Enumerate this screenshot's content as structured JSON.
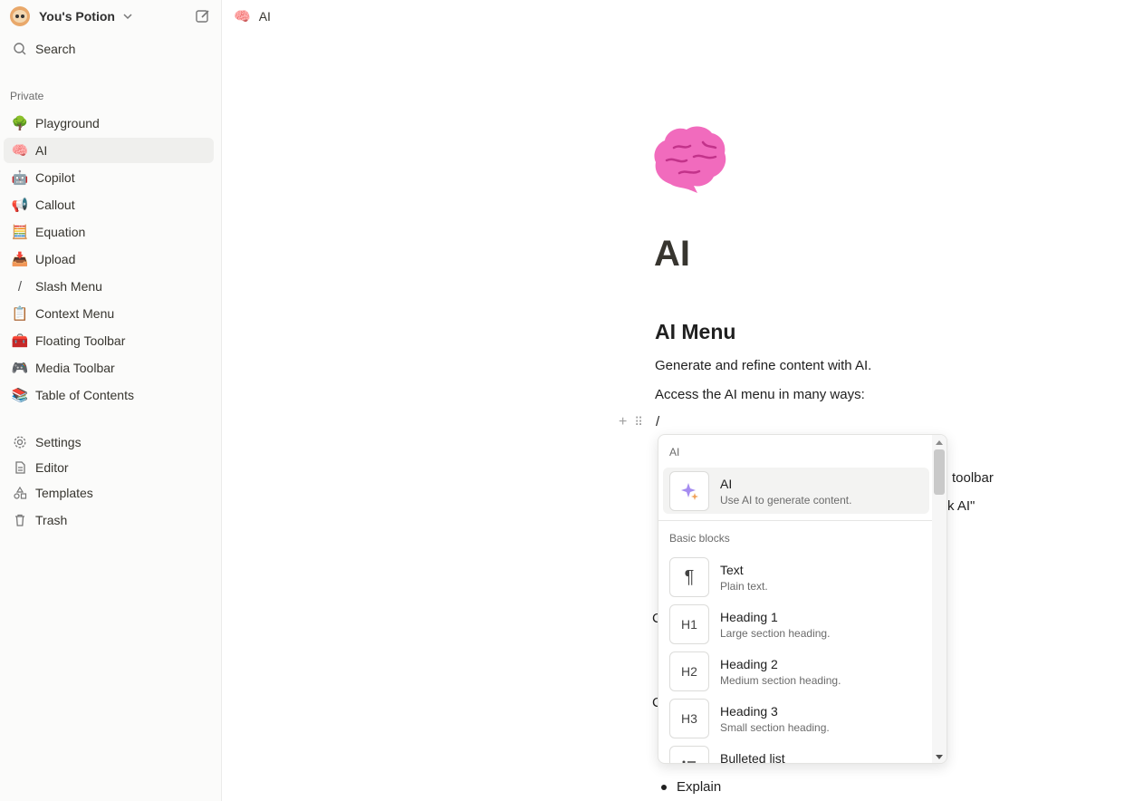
{
  "workspace": {
    "name": "You's Potion"
  },
  "sidebar": {
    "search_label": "Search",
    "section_label": "Private",
    "pages": [
      {
        "label": "Playground",
        "icon": "tree-icon",
        "glyph": "🌳"
      },
      {
        "label": "AI",
        "icon": "brain-icon",
        "glyph": "🧠"
      },
      {
        "label": "Copilot",
        "icon": "robot-icon",
        "glyph": "🤖"
      },
      {
        "label": "Callout",
        "icon": "megaphone-icon",
        "glyph": "📢"
      },
      {
        "label": "Equation",
        "icon": "abacus-icon",
        "glyph": "🧮"
      },
      {
        "label": "Upload",
        "icon": "inbox-tray-icon",
        "glyph": "📥"
      },
      {
        "label": "Slash Menu",
        "icon": "slash-icon",
        "glyph": "/"
      },
      {
        "label": "Context Menu",
        "icon": "clipboard-icon",
        "glyph": "📋"
      },
      {
        "label": "Floating Toolbar",
        "icon": "toolbox-icon",
        "glyph": "🧰"
      },
      {
        "label": "Media Toolbar",
        "icon": "gamepad-icon",
        "glyph": "🎮"
      },
      {
        "label": "Table of Contents",
        "icon": "books-icon",
        "glyph": "📚"
      }
    ],
    "bottom": [
      {
        "label": "Settings",
        "icon": "gear-icon"
      },
      {
        "label": "Editor",
        "icon": "document-icon"
      },
      {
        "label": "Templates",
        "icon": "shapes-icon"
      },
      {
        "label": "Trash",
        "icon": "trash-icon"
      }
    ]
  },
  "topbar": {
    "page_title": "AI",
    "icon": "brain-icon",
    "glyph": "🧠"
  },
  "content": {
    "title": "AI",
    "heading": "AI Menu",
    "paragraphs": [
      "Generate and refine content with AI.",
      "Access the AI menu in many ways:"
    ],
    "slash_text": "/",
    "peek": {
      "toolbar": "toolbar",
      "ask_ai": "k AI\"",
      "c1": "C",
      "c2": "C",
      "explain": "Explain"
    }
  },
  "slash_menu": {
    "groups": [
      {
        "label": "AI"
      },
      {
        "label": "Basic blocks"
      }
    ],
    "items": [
      {
        "title": "AI",
        "desc": "Use AI to generate content.",
        "icon": "sparkles-icon"
      },
      {
        "title": "Text",
        "desc": "Plain text.",
        "icon": "pilcrow-icon",
        "glyph": "¶"
      },
      {
        "title": "Heading 1",
        "desc": "Large section heading.",
        "icon": "heading-1-icon",
        "glyph": "H1"
      },
      {
        "title": "Heading 2",
        "desc": "Medium section heading.",
        "icon": "heading-2-icon",
        "glyph": "H2"
      },
      {
        "title": "Heading 3",
        "desc": "Small section heading.",
        "icon": "heading-3-icon",
        "glyph": "H3"
      },
      {
        "title": "Bulleted list",
        "desc": "",
        "icon": "bulleted-list-icon"
      }
    ]
  },
  "colors": {
    "active_bg": "#efefed",
    "brain_pink": "#f16bbd",
    "sidebar_bg": "#fbfbfa"
  }
}
